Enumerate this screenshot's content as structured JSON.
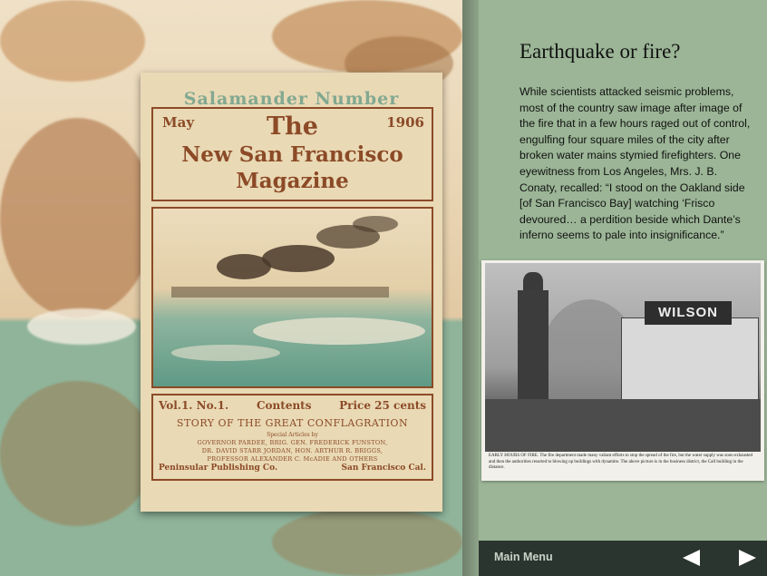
{
  "cover": {
    "banner": "Salamander Number",
    "month": "May",
    "year": "1906",
    "title_line1": "The",
    "title_line2": "New San Francisco",
    "title_line3": "Magazine",
    "volume": "Vol.1. No.1.",
    "contents_label": "Contents",
    "price": "Price 25 cents",
    "story": "STORY OF THE GREAT CONFLAGRATION",
    "special": "Special Articles by",
    "authors_line1": "GOVERNOR PARDEE, BRIG. GEN. FREDERICK FUNSTON,",
    "authors_line2": "DR. DAVID STARR JORDAN, HON. ARTHUR R. BRIGGS,",
    "authors_line3": "PROFESSOR ALEXANDER C. McADIE AND OTHERS",
    "publisher": "Peninsular Publishing Co.",
    "city": "San Francisco Cal."
  },
  "article": {
    "title": "Earthquake or fire?",
    "body": "While scientists attacked seismic problems, most of the country saw image after image of the fire that in a few hours raged out of control, engulfing four square miles of the city after broken water mains stymied firefighters. One eyewitness from Los Angeles, Mrs. J. B. Conaty, recalled: “I stood on the Oakland side [of San Francisco Bay] watching ‘Frisco devoured… a perdition beside which Dante’s inferno seems to pale into insignificance.”"
  },
  "photo": {
    "sign": "WILSON",
    "caption": "EARLY HOURS OF FIRE. The fire department made many valiant efforts to stop the spread of the fire, but the water supply was soon exhausted and then the authorities resorted to blowing up buildings with dynamite. The above picture is in the business district, the Call building in the distance."
  },
  "nav": {
    "main_menu": "Main Menu",
    "prev_icon": "left-arrow-icon",
    "next_icon": "right-arrow-icon"
  }
}
